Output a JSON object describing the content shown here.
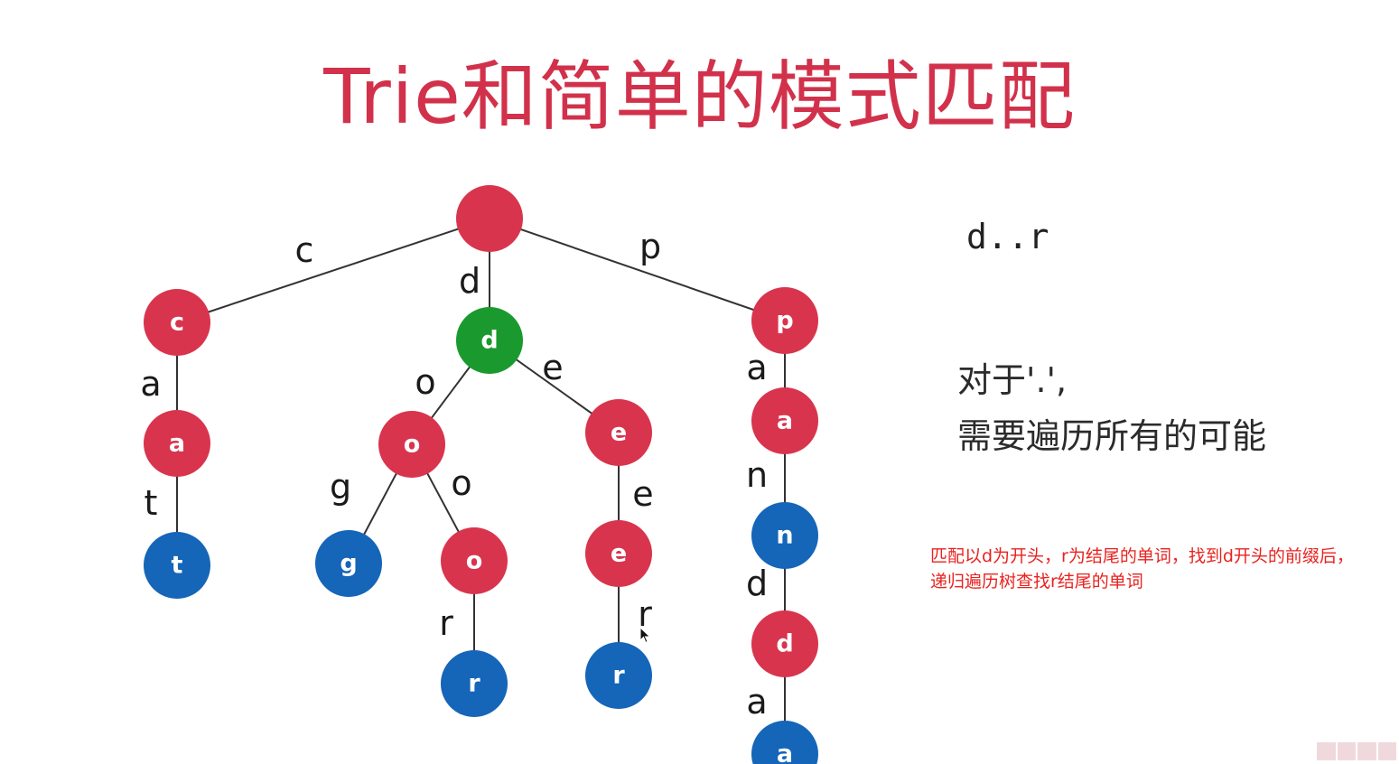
{
  "title": "Trie和简单的模式匹配",
  "pattern": "d..r",
  "note": {
    "line1": "对于'.',",
    "line2": "需要遍历所有的可能"
  },
  "annotation": "匹配以d为开头，r为结尾的单词，找到d开头的前缀后，递归遍历树查找r结尾的单词",
  "colors": {
    "red": "#d9344d",
    "green": "#1a9a2e",
    "blue": "#1565b8",
    "title": "#d2314b",
    "annotation": "#e8231f"
  },
  "tree": {
    "nodes": [
      {
        "id": "root",
        "label": "",
        "color": "red"
      },
      {
        "id": "c",
        "label": "c",
        "color": "red"
      },
      {
        "id": "d",
        "label": "d",
        "color": "green"
      },
      {
        "id": "p",
        "label": "p",
        "color": "red"
      },
      {
        "id": "ca",
        "label": "a",
        "color": "red"
      },
      {
        "id": "cat",
        "label": "t",
        "color": "blue"
      },
      {
        "id": "do",
        "label": "o",
        "color": "red"
      },
      {
        "id": "de",
        "label": "e",
        "color": "red"
      },
      {
        "id": "dog",
        "label": "g",
        "color": "blue"
      },
      {
        "id": "doo",
        "label": "o",
        "color": "red"
      },
      {
        "id": "door",
        "label": "r",
        "color": "blue"
      },
      {
        "id": "dee",
        "label": "e",
        "color": "red"
      },
      {
        "id": "deer",
        "label": "r",
        "color": "blue"
      },
      {
        "id": "pa",
        "label": "a",
        "color": "red"
      },
      {
        "id": "pan",
        "label": "n",
        "color": "blue"
      },
      {
        "id": "pand",
        "label": "d",
        "color": "red"
      },
      {
        "id": "panda",
        "label": "a",
        "color": "blue"
      }
    ],
    "edges": [
      {
        "from": "root",
        "to": "c",
        "label": "c"
      },
      {
        "from": "root",
        "to": "d",
        "label": "d"
      },
      {
        "from": "root",
        "to": "p",
        "label": "p"
      },
      {
        "from": "c",
        "to": "ca",
        "label": "a"
      },
      {
        "from": "ca",
        "to": "cat",
        "label": "t"
      },
      {
        "from": "d",
        "to": "do",
        "label": "o"
      },
      {
        "from": "d",
        "to": "de",
        "label": "e"
      },
      {
        "from": "do",
        "to": "dog",
        "label": "g"
      },
      {
        "from": "do",
        "to": "doo",
        "label": "o"
      },
      {
        "from": "doo",
        "to": "door",
        "label": "r"
      },
      {
        "from": "de",
        "to": "dee",
        "label": "e"
      },
      {
        "from": "dee",
        "to": "deer",
        "label": "r"
      },
      {
        "from": "p",
        "to": "pa",
        "label": "a"
      },
      {
        "from": "pa",
        "to": "pan",
        "label": "n"
      },
      {
        "from": "pan",
        "to": "pand",
        "label": "d"
      },
      {
        "from": "pand",
        "to": "panda",
        "label": "a"
      }
    ]
  }
}
